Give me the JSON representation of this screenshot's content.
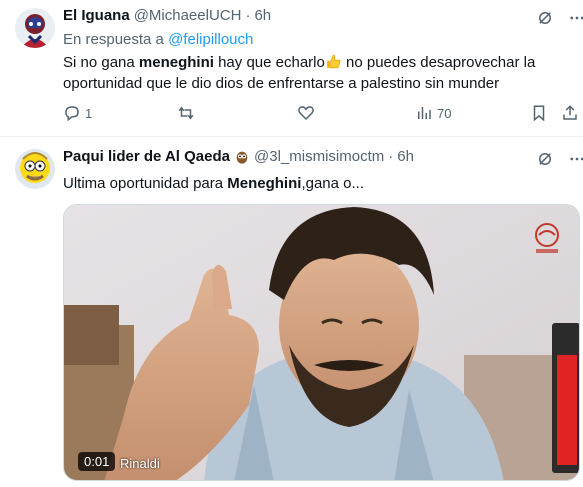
{
  "tweet1": {
    "name": "El Iguana",
    "handle": "@MichaeelUCH",
    "dot": "·",
    "time": "6h",
    "reply_prefix": "En respuesta a",
    "reply_handle": "@felipillouch",
    "text_a": "Si no gana ",
    "text_bold": "meneghini",
    "text_b": " hay que echarlo",
    "text_c": " no puedes desaprovechar la oportunidad que le dio dios de enfrentarse a palestino sin munder",
    "emoji": "thumbs-up",
    "actions": {
      "replies": "1",
      "retweets": "",
      "likes": "",
      "views": "70"
    }
  },
  "tweet2": {
    "name": "Paqui lider de Al Qaeda",
    "emoji": "owl",
    "handle": "@3l_mismisimoctm",
    "dot": "·",
    "time": "6h",
    "text_a": "Ultima oportunidad para ",
    "text_bold": "Meneghini",
    "text_b": ",gana o...",
    "video": {
      "timestamp": "0:01",
      "caption": "Rinaldi"
    }
  },
  "icons": [
    "grok-icon",
    "more-icon",
    "reply-icon",
    "retweet-icon",
    "like-icon",
    "views-icon",
    "bookmark-icon",
    "share-icon"
  ],
  "colors": {
    "text": "#0f1419",
    "secondary": "#536471",
    "link": "#1d9bf0",
    "divider": "#eff3f4"
  }
}
